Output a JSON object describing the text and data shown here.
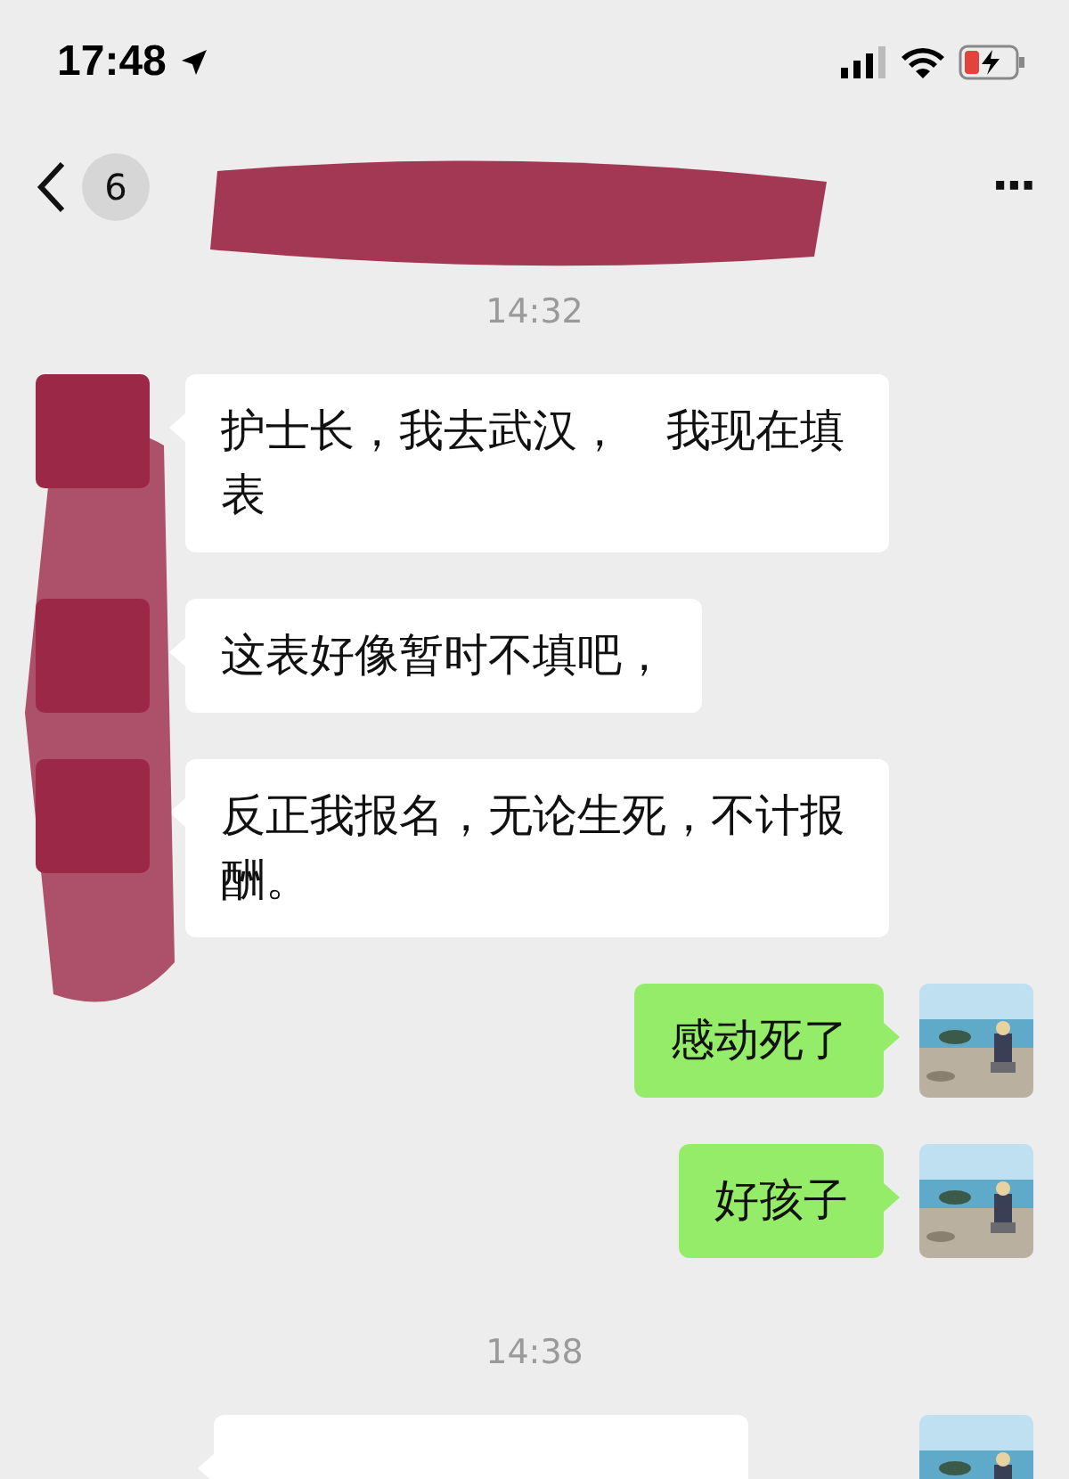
{
  "status_bar": {
    "time": "17:48",
    "battery_low": true,
    "charging": true
  },
  "header": {
    "back_badge": "6",
    "title_redacted": true,
    "more": "···"
  },
  "messages": [
    {
      "kind": "time",
      "text": "14:32"
    },
    {
      "kind": "received",
      "text": "护士长，我去武汉，　我现在填表"
    },
    {
      "kind": "received",
      "text": "这表好像暂时不填吧，"
    },
    {
      "kind": "received",
      "text": "反正我报名，无论生死，不计报酬。"
    },
    {
      "kind": "sent",
      "text": "感动死了"
    },
    {
      "kind": "sent",
      "text": "好孩子"
    },
    {
      "kind": "time",
      "text": "14:38"
    },
    {
      "kind": "received_partial"
    }
  ]
}
